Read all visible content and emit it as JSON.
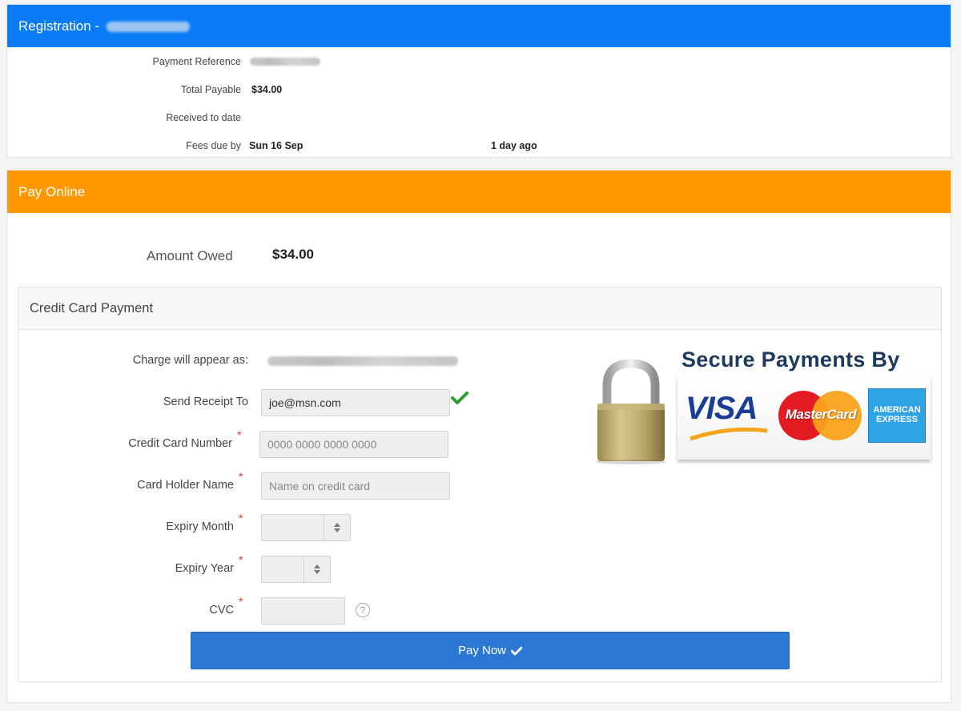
{
  "registration": {
    "title": "Registration -",
    "payment_reference_label": "Payment Reference",
    "total_payable_label": "Total Payable",
    "total_payable_value": "$34.00",
    "received_label": "Received to date",
    "fees_due_label": "Fees due by",
    "fees_due_value": "Sun 16 Sep",
    "fees_due_relative": "1 day ago"
  },
  "pay_online": {
    "title": "Pay Online",
    "amount_owed_label": "Amount Owed",
    "amount_owed_value": "$34.00"
  },
  "credit_card": {
    "title": "Credit Card Payment",
    "charge_label": "Charge will appear as:",
    "receipt_label": "Send Receipt To",
    "receipt_value": "joe@msn.com",
    "card_number_label": "Credit Card Number",
    "card_number_placeholder": "0000 0000 0000 0000",
    "holder_label": "Card Holder Name",
    "holder_placeholder": "Name on credit card",
    "expiry_month_label": "Expiry Month",
    "expiry_year_label": "Expiry Year",
    "cvc_label": "CVC",
    "required_mark": "*",
    "help_icon_text": "?",
    "pay_button_label": "Pay Now"
  },
  "secure_banner": {
    "heading": "Secure Payments By",
    "visa": "VISA",
    "mastercard": "MasterCard",
    "amex_line1": "AMERICAN",
    "amex_line2": "EXPRESS"
  },
  "colors": {
    "registration_header": "#0a7cf6",
    "pay_online_header": "#ff9800",
    "pay_button": "#2b78d4",
    "check_green": "#2e9c2e"
  },
  "icons": [
    "check-icon",
    "padlock-icon",
    "select-updown-icon",
    "help-icon"
  ]
}
